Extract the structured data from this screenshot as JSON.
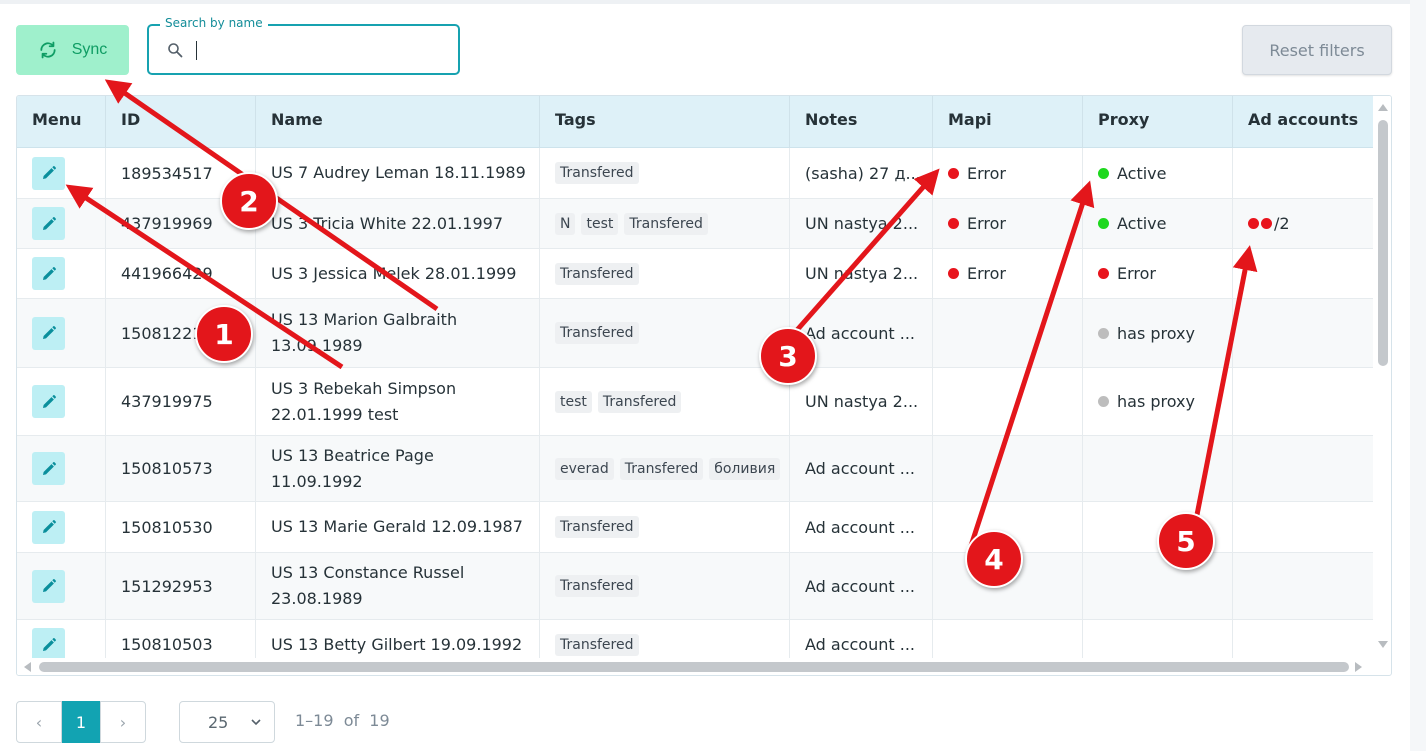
{
  "toolbar": {
    "sync_label": "Sync",
    "search_label": "Search by name",
    "search_value": "",
    "reset_label": "Reset filters"
  },
  "columns": [
    "Menu",
    "ID",
    "Name",
    "Tags",
    "Notes",
    "Mapi",
    "Proxy",
    "Ad accounts"
  ],
  "rows": [
    {
      "id": "189534517",
      "name": [
        "US 7 Audrey Leman 18.11.1989"
      ],
      "tags": [
        "Transfered"
      ],
      "notes": "(sasha) 27 д...",
      "mapi": "Error",
      "mapi_color": "red",
      "proxy": "Active",
      "proxy_color": "green",
      "ad_accounts": ""
    },
    {
      "id": "437919969",
      "name": [
        "US 3 Tricia White 22.01.1997"
      ],
      "tags": [
        "N",
        "test",
        "Transfered"
      ],
      "notes": "UN nastya 2...",
      "mapi": "Error",
      "mapi_color": "red",
      "proxy": "Active",
      "proxy_color": "green",
      "ad_accounts": "/2"
    },
    {
      "id": "441966429",
      "name": [
        "US 3 Jessica Melek 28.01.1999"
      ],
      "tags": [
        "Transfered"
      ],
      "notes": "UN nastya 2...",
      "mapi": "Error",
      "mapi_color": "red",
      "proxy": "Error",
      "proxy_color": "red",
      "ad_accounts": ""
    },
    {
      "id": "150812210",
      "name": [
        "US 13 Marion Galbraith",
        "13.09.1989"
      ],
      "tags": [
        "Transfered"
      ],
      "notes": "Ad account ...",
      "mapi": "",
      "mapi_color": "",
      "proxy": "has proxy",
      "proxy_color": "gray",
      "ad_accounts": ""
    },
    {
      "id": "437919975",
      "name": [
        "US 3 Rebekah Simpson",
        "22.01.1999 test"
      ],
      "tags": [
        "test",
        "Transfered"
      ],
      "notes": "UN nastya 2...",
      "mapi": "",
      "mapi_color": "",
      "proxy": "has proxy",
      "proxy_color": "gray",
      "ad_accounts": ""
    },
    {
      "id": "150810573",
      "name": [
        "US 13 Beatrice Page 11.09.1992"
      ],
      "tags": [
        "everad",
        "Transfered",
        "боливия"
      ],
      "notes": "Ad account ...",
      "mapi": "",
      "mapi_color": "",
      "proxy": "",
      "proxy_color": "",
      "ad_accounts": ""
    },
    {
      "id": "150810530",
      "name": [
        "US 13 Marie Gerald 12.09.1987"
      ],
      "tags": [
        "Transfered"
      ],
      "notes": "Ad account ...",
      "mapi": "",
      "mapi_color": "",
      "proxy": "",
      "proxy_color": "",
      "ad_accounts": ""
    },
    {
      "id": "151292953",
      "name": [
        "US 13 Constance Russel",
        "23.08.1989"
      ],
      "tags": [
        "Transfered"
      ],
      "notes": "Ad account ...",
      "mapi": "",
      "mapi_color": "",
      "proxy": "",
      "proxy_color": "",
      "ad_accounts": ""
    },
    {
      "id": "150810503",
      "name": [
        "US 13 Betty Gilbert 19.09.1992"
      ],
      "tags": [
        "Transfered"
      ],
      "notes": "Ad account ...",
      "mapi": "",
      "mapi_color": "",
      "proxy": "",
      "proxy_color": "",
      "ad_accounts": ""
    }
  ],
  "pagination": {
    "prev_icon": "‹",
    "current_page": "1",
    "next_icon": "›",
    "per_page": "25",
    "range_text": "1–19  of  19"
  },
  "annotations": [
    "1",
    "2",
    "3",
    "4",
    "5"
  ],
  "colors": {
    "accent": "#12a3b2",
    "sync_bg": "#9ff0cc",
    "error": "#e8141c",
    "active": "#1ed81e",
    "annotation": "#e3161b"
  }
}
